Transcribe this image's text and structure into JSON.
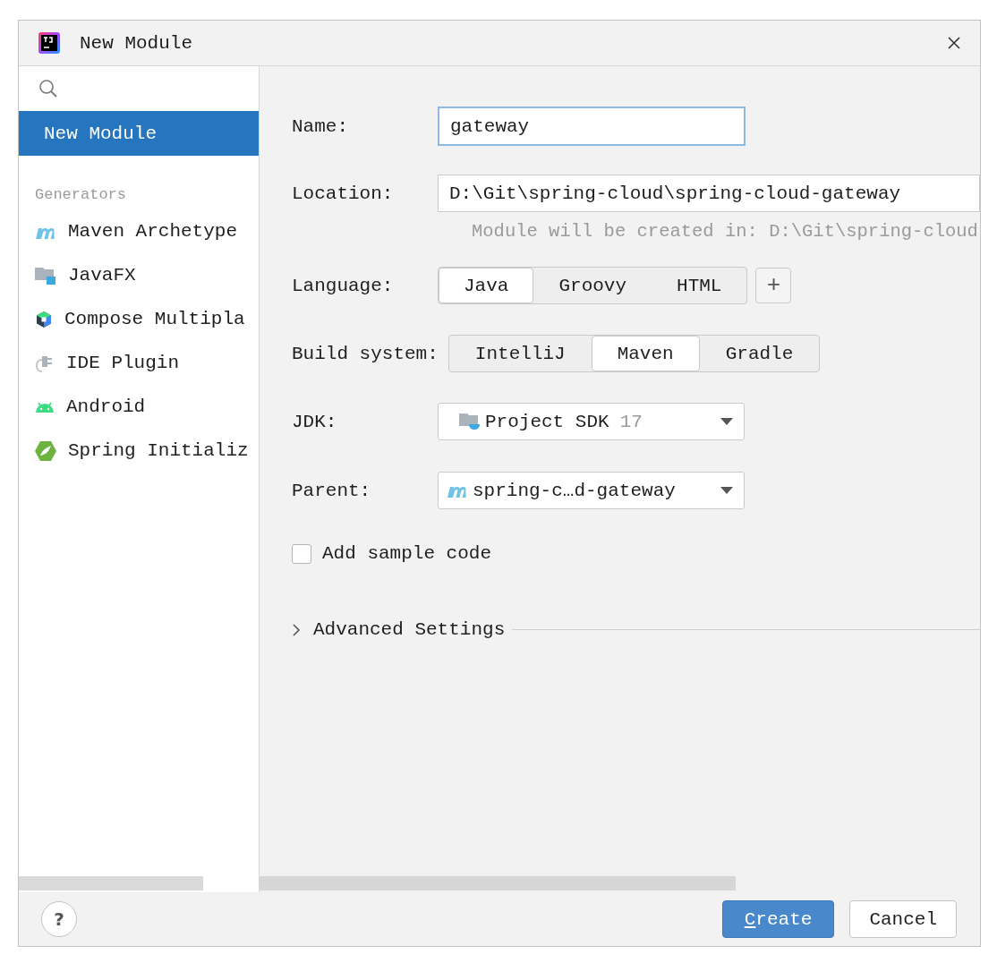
{
  "window": {
    "title": "New Module"
  },
  "sidebar": {
    "items": [
      {
        "label": "New Module",
        "selected": true
      }
    ],
    "section": "Generators",
    "generators": [
      {
        "label": "Maven Archetype",
        "kind": "maven"
      },
      {
        "label": "JavaFX",
        "kind": "javafx"
      },
      {
        "label": "Compose Multipla",
        "kind": "compose"
      },
      {
        "label": "IDE Plugin",
        "kind": "plugin"
      },
      {
        "label": "Android",
        "kind": "android"
      },
      {
        "label": "Spring Initializ",
        "kind": "spring"
      }
    ]
  },
  "form": {
    "name": {
      "label": "Name:",
      "value": "gateway"
    },
    "location": {
      "label": "Location:",
      "value": "D:\\Git\\spring-cloud\\spring-cloud-gateway",
      "hint": "Module will be created in: D:\\Git\\spring-cloud"
    },
    "language": {
      "label": "Language:",
      "options": [
        {
          "label": "Java",
          "selected": true
        },
        {
          "label": "Groovy",
          "selected": false
        },
        {
          "label": "HTML",
          "selected": false
        }
      ],
      "add": "+"
    },
    "build_system": {
      "label": "Build system:",
      "options": [
        {
          "label": "IntelliJ",
          "selected": false
        },
        {
          "label": "Maven",
          "selected": true
        },
        {
          "label": "Gradle",
          "selected": false
        }
      ]
    },
    "jdk": {
      "label": "JDK:",
      "value": "Project SDK",
      "version": "17"
    },
    "parent": {
      "label": "Parent:",
      "value": "spring-c…d-gateway"
    },
    "sample_code": {
      "label": "Add sample code",
      "checked": false
    },
    "advanced": {
      "label": "Advanced Settings",
      "expanded": false
    }
  },
  "footer": {
    "help": "?",
    "buttons": [
      {
        "label": "Create",
        "primary": true
      },
      {
        "label": "Cancel",
        "primary": false
      }
    ]
  }
}
